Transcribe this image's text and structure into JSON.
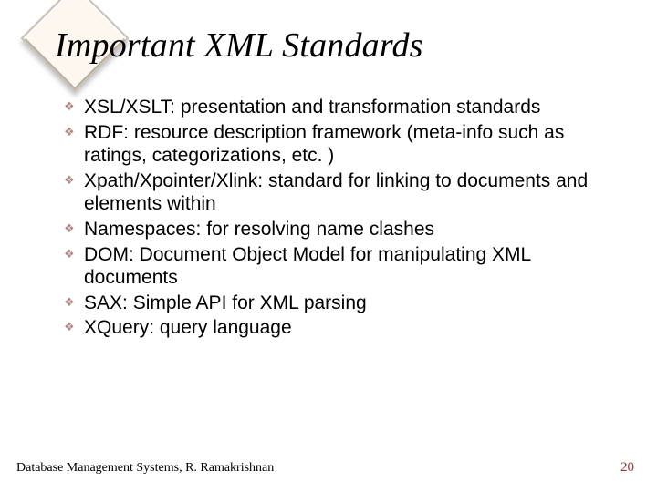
{
  "title": "Important XML Standards",
  "bullets": [
    "XSL/XSLT:  presentation and transformation standards",
    "RDF:  resource description framework (meta-info such as ratings, categorizations, etc. )",
    "Xpath/Xpointer/Xlink:  standard for linking to documents and elements within",
    "Namespaces:  for resolving name clashes",
    "DOM:  Document Object Model for manipulating XML documents",
    "SAX:  Simple API for XML parsing",
    "XQuery: query language"
  ],
  "footer_left": "Database Management Systems, R. Ramakrishnan",
  "page_number": "20"
}
